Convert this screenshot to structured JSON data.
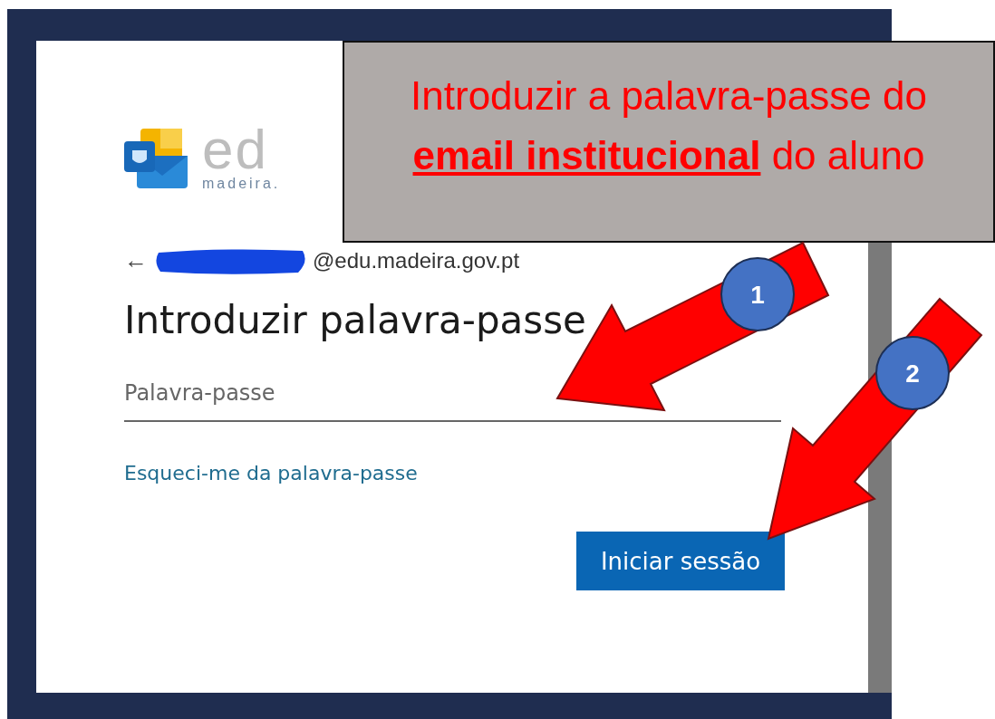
{
  "logo": {
    "word": "ed",
    "subtitle": "madeira."
  },
  "account": {
    "back_icon": "←",
    "email": "@edu.madeira.gov.pt"
  },
  "heading": "Introduzir palavra-passe",
  "password_field": {
    "placeholder": "Palavra-passe"
  },
  "forgot_link": "Esqueci-me da palavra-passe",
  "buttons": [
    "Iniciar sessão"
  ],
  "annotation": {
    "text": "Introduzir a palavra-passe do **email institucional** do aluno",
    "markers": [
      {
        "label": "1"
      },
      {
        "label": "2"
      }
    ]
  }
}
